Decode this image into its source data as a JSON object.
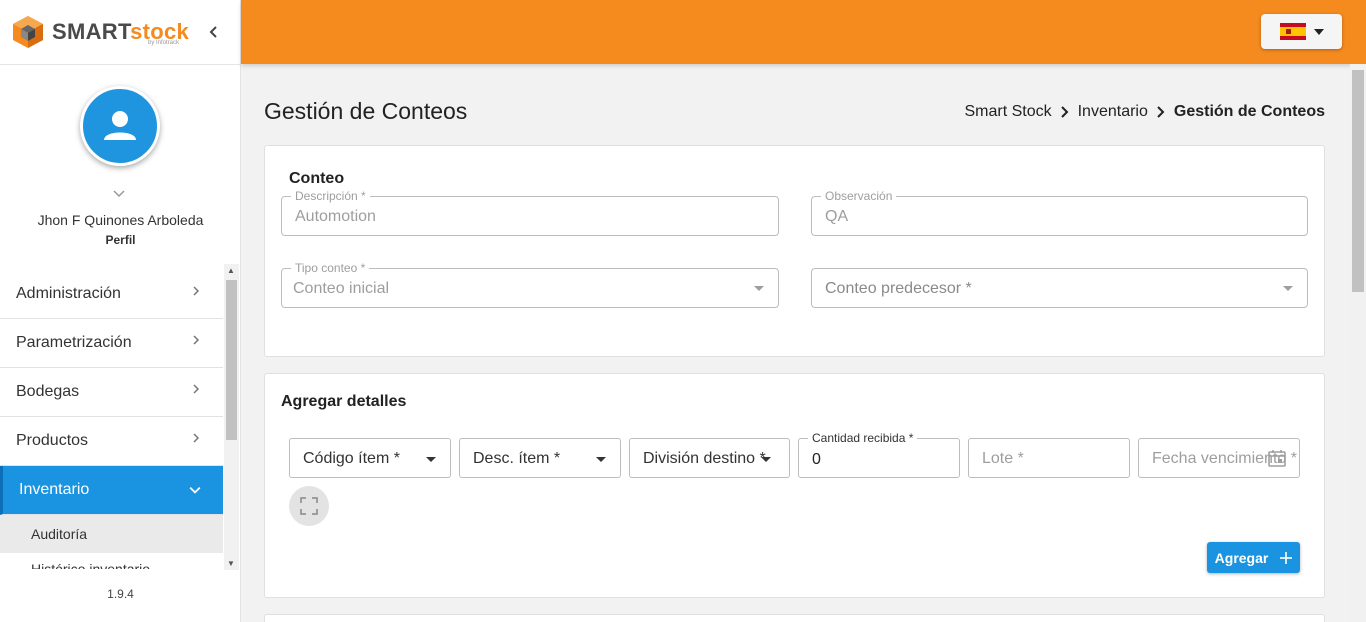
{
  "brand": {
    "name_part1": "SMART",
    "name_part2": "stock",
    "sub": "by Infotrack"
  },
  "user": {
    "name": "Jhon F Quinones Arboleda",
    "profile_label": "Perfil"
  },
  "menu": {
    "items": [
      {
        "label": "Administración"
      },
      {
        "label": "Parametrización"
      },
      {
        "label": "Bodegas"
      },
      {
        "label": "Productos"
      },
      {
        "label": "Inventario"
      }
    ],
    "sub_items": [
      {
        "label": "Auditoría"
      },
      {
        "label": "Histórico inventario"
      }
    ]
  },
  "version": "1.9.4",
  "page": {
    "title": "Gestión de Conteos",
    "breadcrumb": [
      "Smart Stock",
      "Inventario",
      "Gestión de Conteos"
    ]
  },
  "conteo": {
    "title": "Conteo",
    "descripcion": {
      "label": "Descripción *",
      "value": "Automotion"
    },
    "observacion": {
      "label": "Observación",
      "value": "QA"
    },
    "tipo_conteo": {
      "label": "Tipo conteo *",
      "value": "Conteo inicial"
    },
    "conteo_predecesor": {
      "placeholder": "Conteo predecesor *"
    }
  },
  "detalles": {
    "title": "Agregar detalles",
    "codigo_item": "Código ítem *",
    "desc_item": "Desc. ítem *",
    "division_destino": "División destino *",
    "cantidad_recibida": {
      "label": "Cantidad recibida *",
      "value": "0"
    },
    "lote": "Lote *",
    "fecha_vencimiento": "Fecha vencimiento *",
    "add_button": "Agregar"
  },
  "colors": {
    "topbar": "#f58a1f",
    "primary": "#1a94e0"
  }
}
